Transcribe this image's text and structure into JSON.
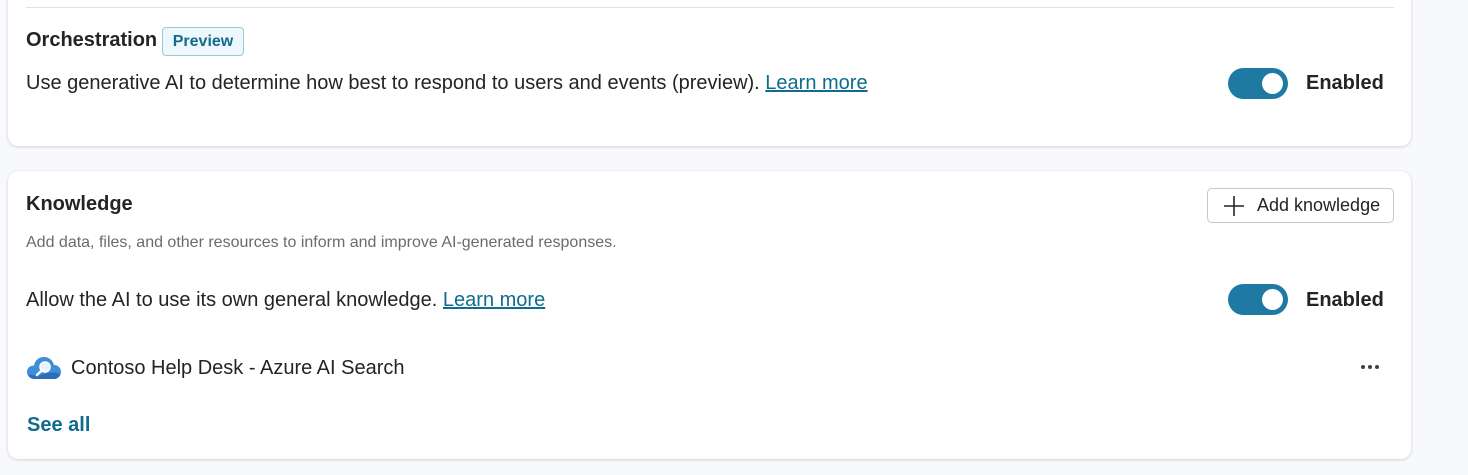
{
  "orchestration": {
    "title": "Orchestration",
    "badge": "Preview",
    "description": "Use generative AI to determine how best to respond to users and events (preview). ",
    "learn_more": "Learn more",
    "toggle_label": "Enabled",
    "toggle_on": true
  },
  "knowledge": {
    "title": "Knowledge",
    "add_button_label": "Add knowledge",
    "subtitle": "Add data, files, and other resources to inform and improve AI-generated responses.",
    "general_knowledge": {
      "text": "Allow the AI to use its own general knowledge. ",
      "learn_more": "Learn more",
      "toggle_label": "Enabled",
      "toggle_on": true
    },
    "sources": [
      {
        "name": "Contoso Help Desk - Azure AI Search",
        "icon": "azure-ai-search-icon"
      }
    ],
    "see_all": "See all"
  },
  "colors": {
    "accent": "#1e7aa3",
    "link": "#0f6c8d",
    "badge_bg": "#eef7fb",
    "page_bg": "#f8f9fc"
  }
}
